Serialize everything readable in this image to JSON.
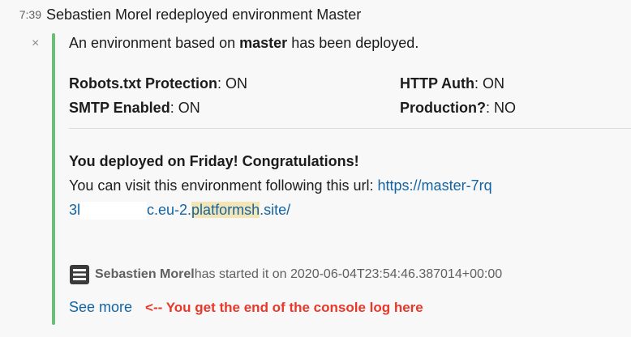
{
  "message": {
    "time": "7:39",
    "text": "Sebastien Morel redeployed environment Master"
  },
  "attachment": {
    "close_glyph": "×",
    "accent_color": "#6cbd78",
    "pretext_before": "An environment based on ",
    "pretext_bold": "master",
    "pretext_after": " has been deployed.",
    "fields": [
      {
        "key": "Robots.txt Protection",
        "value": ": ON"
      },
      {
        "key": "HTTP Auth",
        "value": ": ON"
      },
      {
        "key": "SMTP Enabled",
        "value": ": ON"
      },
      {
        "key": "Production?",
        "value": ": NO"
      }
    ],
    "congrats": "You deployed on Friday! Congratulations!",
    "visit_text": "You can visit this environment following this url: ",
    "url_line1": "https://master-7rq",
    "url_line2_start": "3l",
    "url_line2_mid": "c.eu-2.",
    "url_line2_highlight": "platformsh",
    "url_line2_end": ".site/",
    "footer": {
      "icon": "list-icon",
      "author": "Sebastien Morel",
      "text": " has started it on 2020-06-04T23:54:46.387014+00:00"
    },
    "see_more": "See more",
    "annotation": "<-- You get the end of the console log here",
    "annotation_color": "#e8382a"
  }
}
